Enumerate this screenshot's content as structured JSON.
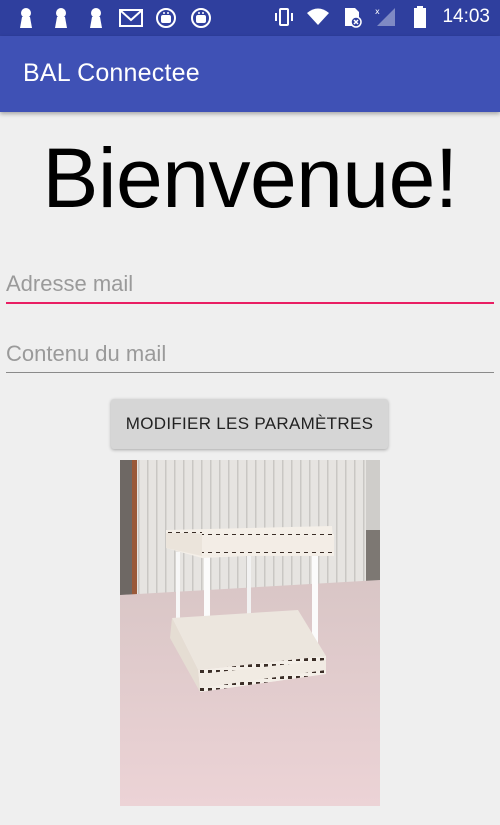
{
  "status_bar": {
    "time": "14:03",
    "left_icons": [
      "keyhole-icon",
      "keyhole-icon",
      "keyhole-icon",
      "mail-icon",
      "android-icon",
      "android-icon"
    ],
    "right_icons": [
      "vibrate-icon",
      "wifi-icon",
      "sd-card-icon",
      "signal-icon",
      "battery-icon"
    ]
  },
  "app_bar": {
    "title": "BAL Connectee",
    "color": "#3f51b5"
  },
  "welcome": "Bienvenue!",
  "email_field": {
    "placeholder": "Adresse mail",
    "value": "",
    "underline_color": "#e91e63"
  },
  "content_field": {
    "placeholder": "Contenu du mail",
    "value": ""
  },
  "settings_button": {
    "label": "MODIFIER LES PARAMÈTRES"
  },
  "photo": {
    "subject": "wooden-mailbox-frame-photo"
  }
}
